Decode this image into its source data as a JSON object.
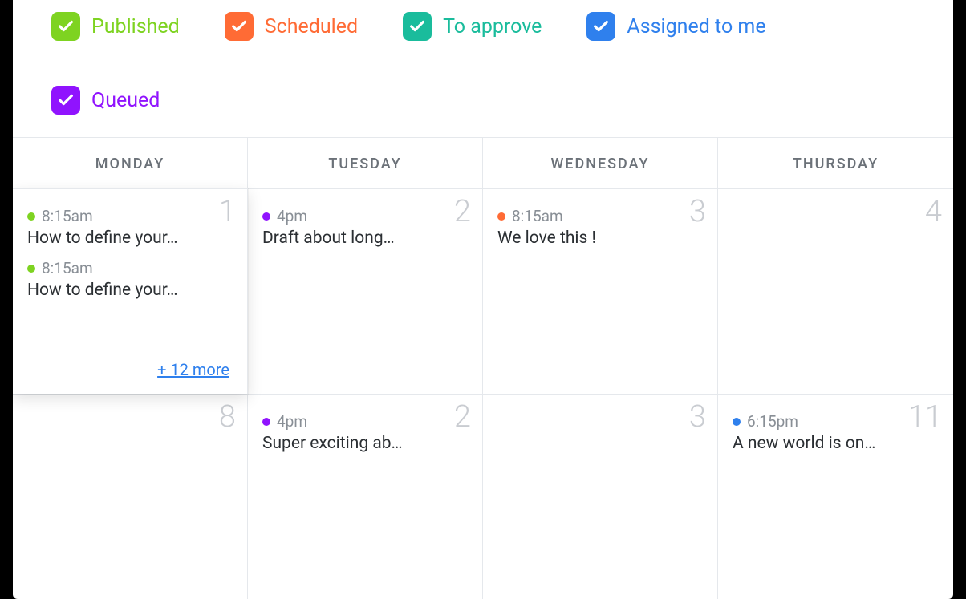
{
  "colors": {
    "published": "#7ed321",
    "scheduled": "#ff6b35",
    "to_approve": "#1abc9c",
    "assigned": "#2f80ed",
    "queued": "#9013fe"
  },
  "filters": [
    {
      "key": "published",
      "label": "Published",
      "color": "#7ed321"
    },
    {
      "key": "scheduled",
      "label": "Scheduled",
      "color": "#ff6b35"
    },
    {
      "key": "to_approve",
      "label": "To approve",
      "color": "#1abc9c"
    },
    {
      "key": "assigned",
      "label": "Assigned to me",
      "color": "#2f80ed"
    },
    {
      "key": "queued",
      "label": "Queued",
      "color": "#9013fe"
    }
  ],
  "day_headers": [
    "MONDAY",
    "TUESDAY",
    "WEDNESDAY",
    "THURSDAY"
  ],
  "rows": [
    [
      {
        "num": "1",
        "highlighted": true,
        "events": [
          {
            "time": "8:15am",
            "title": "How to define your…",
            "color": "#7ed321"
          },
          {
            "time": "8:15am",
            "title": "How to define your…",
            "color": "#7ed321"
          }
        ],
        "more": "+ 12 more"
      },
      {
        "num": "2",
        "events": [
          {
            "time": "4pm",
            "title": "Draft about long…",
            "color": "#9013fe"
          }
        ]
      },
      {
        "num": "3",
        "events": [
          {
            "time": "8:15am",
            "title": "We love this !",
            "color": "#ff6b35"
          }
        ]
      },
      {
        "num": "4",
        "events": []
      }
    ],
    [
      {
        "num": "8",
        "events": []
      },
      {
        "num": "2",
        "events": [
          {
            "time": "4pm",
            "title": "Super exciting ab…",
            "color": "#9013fe"
          }
        ]
      },
      {
        "num": "3",
        "events": []
      },
      {
        "num": "11",
        "events": [
          {
            "time": "6:15pm",
            "title": "A new world is on…",
            "color": "#2f80ed"
          }
        ]
      }
    ]
  ]
}
